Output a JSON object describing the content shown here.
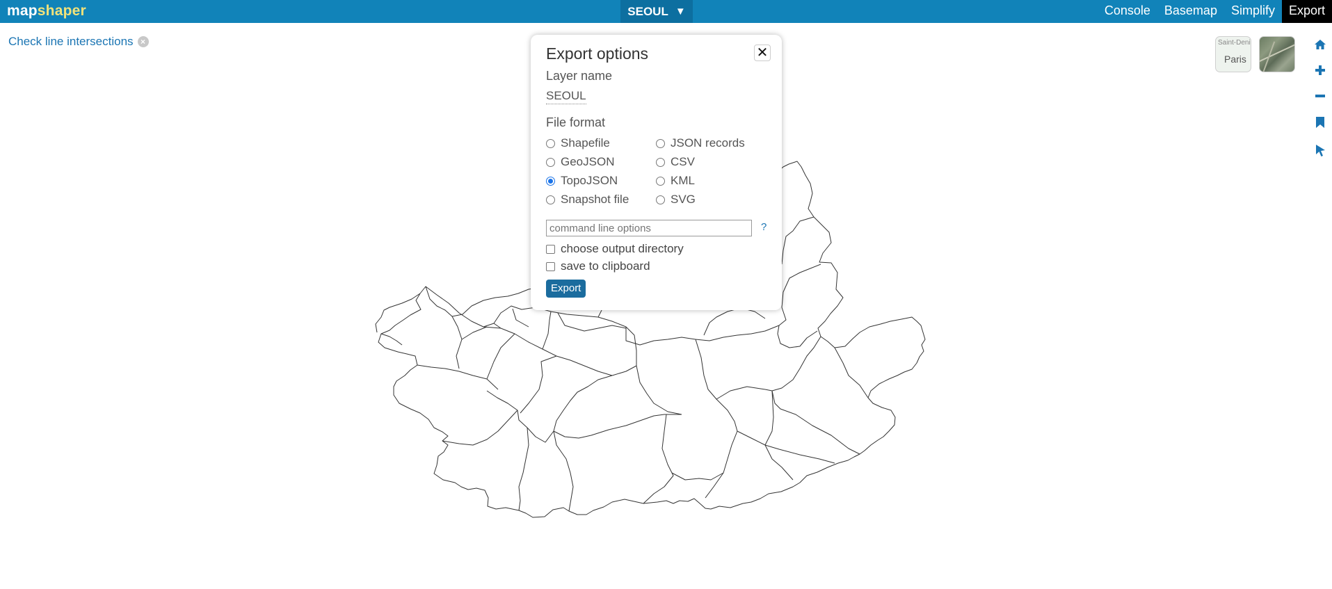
{
  "app": {
    "brand_part1": "map",
    "brand_part2": "shaper",
    "layer_button": "SEOUL",
    "menu": [
      "Console",
      "Basemap",
      "Simplify",
      "Export"
    ],
    "active_menu": "Export",
    "accent_color": "#1183b9"
  },
  "check_intersections": {
    "label": "Check line intersections"
  },
  "basemaps": {
    "map1_label_top": "Saint-Deni",
    "map1_label_city": "Paris"
  },
  "tools": [
    "home-icon",
    "zoom-in-icon",
    "zoom-out-icon",
    "bookmark-icon",
    "pointer-icon"
  ],
  "export_dialog": {
    "title": "Export options",
    "close_symbol": "✕",
    "layer_name_label": "Layer name",
    "layer_name_value": "SEOUL",
    "file_format_label": "File format",
    "formats": {
      "shapefile": "Shapefile",
      "geojson": "GeoJSON",
      "topojson": "TopoJSON",
      "snapshot": "Snapshot file",
      "json_records": "JSON records",
      "csv": "CSV",
      "kml": "KML",
      "svg": "SVG"
    },
    "selected_format": "TopoJSON",
    "cmd_placeholder": "command line options",
    "help_symbol": "?",
    "choose_dir_label": "choose output directory",
    "clipboard_label": "save to clipboard",
    "export_button": "Export"
  }
}
